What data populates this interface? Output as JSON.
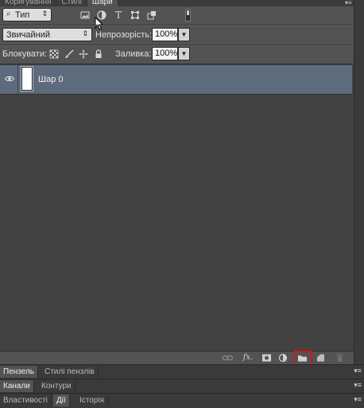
{
  "tabs": [
    {
      "label": "Коригування",
      "active": false
    },
    {
      "label": "Стилі",
      "active": false
    },
    {
      "label": "Шари",
      "active": true
    }
  ],
  "filter": {
    "selected": "Тип",
    "icons": [
      "image-filter-icon",
      "adjustment-filter-icon",
      "type-filter-icon",
      "shape-filter-icon",
      "smart-object-filter-icon"
    ]
  },
  "blend": {
    "mode": "Звичайний",
    "opacity_label": "Непрозорість:",
    "opacity_value": "100%"
  },
  "lock": {
    "label": "Блокувати:",
    "fill_label": "Заливка:",
    "fill_value": "100%"
  },
  "layers": [
    {
      "name": "Шар 0",
      "visible": true,
      "selected": true
    }
  ],
  "bottom_toolbar": {
    "fx_label": "fx.",
    "highlighted": "new-group-button",
    "highlight_color": "#d0161b"
  },
  "docks": [
    {
      "tabs": [
        {
          "label": "Пензель",
          "active": true
        },
        {
          "label": "Стилі пензлів",
          "active": false
        }
      ]
    },
    {
      "tabs": [
        {
          "label": "Канали",
          "active": true
        },
        {
          "label": "Контури",
          "active": false
        }
      ]
    },
    {
      "tabs": [
        {
          "label": "Властивості",
          "active": false
        },
        {
          "label": "Дії",
          "active": true
        },
        {
          "label": "Історія",
          "active": false
        }
      ]
    }
  ],
  "colors": {
    "selected_layer": "#5d6b7d",
    "panel": "#535353",
    "list_bg": "#424242"
  }
}
